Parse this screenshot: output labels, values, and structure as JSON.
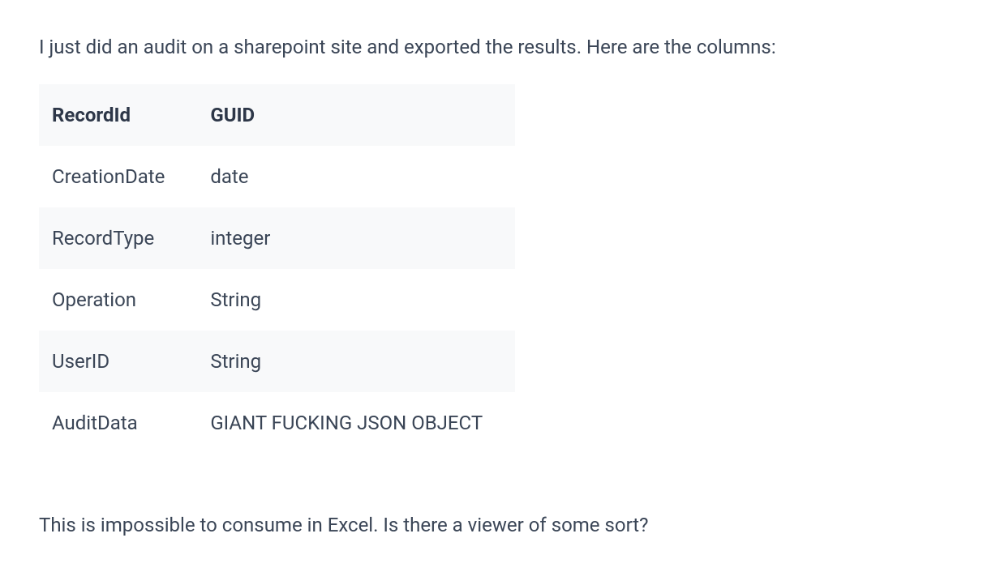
{
  "intro": "I just did an audit on a sharepoint site and exported the results. Here are the columns:",
  "table": {
    "headers": [
      "RecordId",
      "GUID"
    ],
    "rows": [
      [
        "CreationDate",
        "date"
      ],
      [
        "RecordType",
        "integer"
      ],
      [
        "Operation",
        "String"
      ],
      [
        "UserID",
        "String"
      ],
      [
        "AuditData",
        "GIANT FUCKING JSON OBJECT"
      ]
    ]
  },
  "outro": "This is impossible to consume in Excel. Is there a viewer of some sort?"
}
